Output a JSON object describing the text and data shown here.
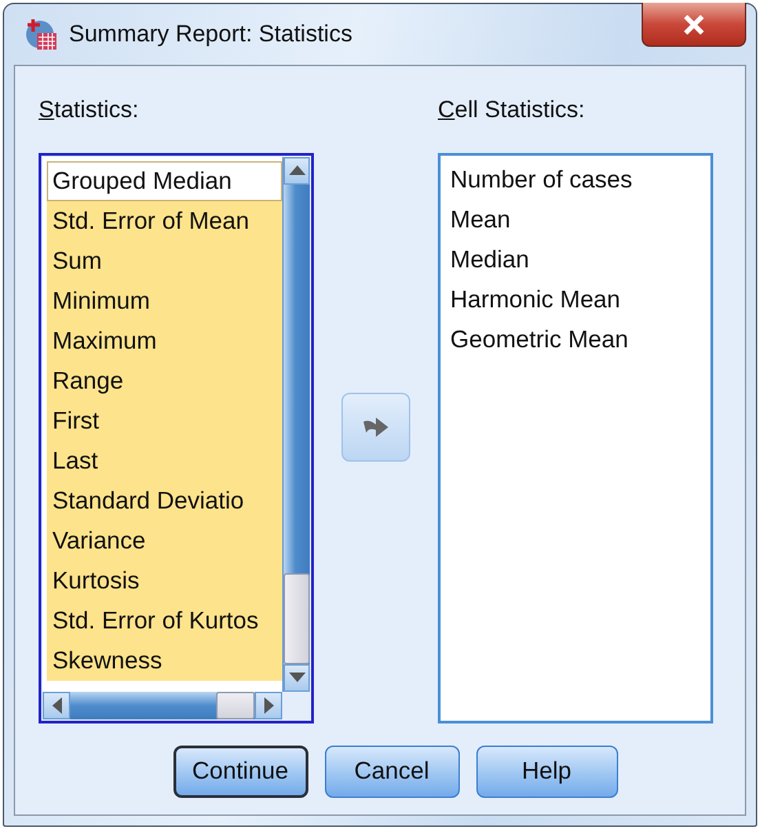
{
  "window": {
    "title": "Summary Report: Statistics"
  },
  "statistics": {
    "mnemonic": "S",
    "label_rest": "tatistics:",
    "items": [
      {
        "text": "Grouped Median",
        "selected": false,
        "focused": true
      },
      {
        "text": "Std. Error of Mean",
        "selected": true,
        "focused": false
      },
      {
        "text": "Sum",
        "selected": true,
        "focused": false
      },
      {
        "text": "Minimum",
        "selected": true,
        "focused": false
      },
      {
        "text": "Maximum",
        "selected": true,
        "focused": false
      },
      {
        "text": "Range",
        "selected": true,
        "focused": false
      },
      {
        "text": "First",
        "selected": true,
        "focused": false
      },
      {
        "text": "Last",
        "selected": true,
        "focused": false
      },
      {
        "text": "Standard Deviatio",
        "selected": true,
        "focused": false
      },
      {
        "text": "Variance",
        "selected": true,
        "focused": false
      },
      {
        "text": "Kurtosis",
        "selected": true,
        "focused": false
      },
      {
        "text": "Std. Error of Kurtos",
        "selected": true,
        "focused": false
      },
      {
        "text": "Skewness",
        "selected": true,
        "focused": false
      }
    ]
  },
  "cell_statistics": {
    "mnemonic": "C",
    "label_rest": "ell Statistics:",
    "items": [
      {
        "text": "Number of cases",
        "selected": false,
        "focused": false
      },
      {
        "text": "Mean",
        "selected": false,
        "focused": false
      },
      {
        "text": "Median",
        "selected": false,
        "focused": false
      },
      {
        "text": "Harmonic Mean",
        "selected": false,
        "focused": false
      },
      {
        "text": "Geometric Mean",
        "selected": false,
        "focused": false
      }
    ]
  },
  "buttons": [
    {
      "label": "Continue",
      "default": true
    },
    {
      "label": "Cancel",
      "default": false
    },
    {
      "label": "Help",
      "default": false
    }
  ]
}
